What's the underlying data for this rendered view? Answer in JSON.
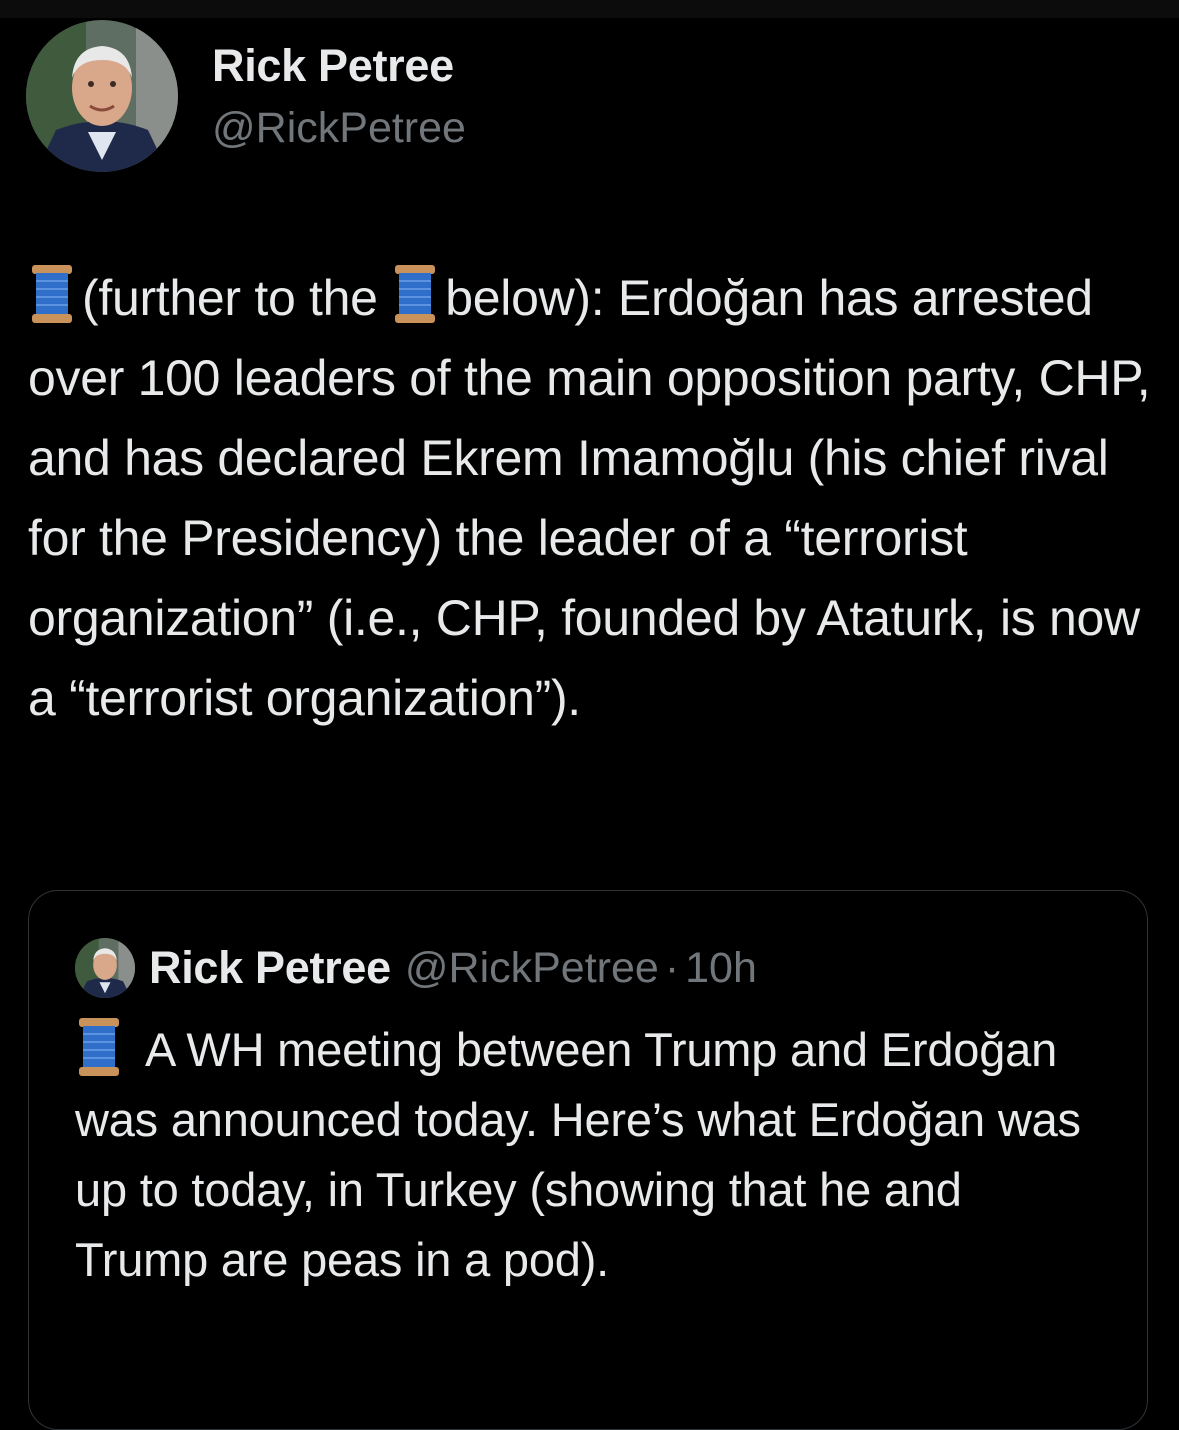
{
  "tweet": {
    "author": {
      "display_name": "Rick Petree",
      "handle": "@RickPetree"
    },
    "thread_icon": "spool-of-thread-icon",
    "text_part1": "(further to the",
    "text_part2": "below): Erdoğan has arrested over 100 leaders of the main opposition party, CHP, and has declared Ekrem Imamoğlu (his chief rival for the Presidency) the leader of a “terrorist organization” (i.e., CHP, founded by Ataturk, is now a “terrorist organization”)."
  },
  "quoted_tweet": {
    "display_name": "Rick Petree",
    "handle": "@RickPetree",
    "separator": "·",
    "time": "10h",
    "text": "A WH meeting between Trump and Erdoğan was announced today. Here’s what Erdoğan was up to today, in Turkey (showing that he and Trump are peas in a pod)."
  },
  "colors": {
    "background": "#000000",
    "text_primary": "#e7e9ea",
    "text_secondary": "#71767b",
    "border": "#2f3336",
    "spool_thread": "#2f6fc9"
  }
}
